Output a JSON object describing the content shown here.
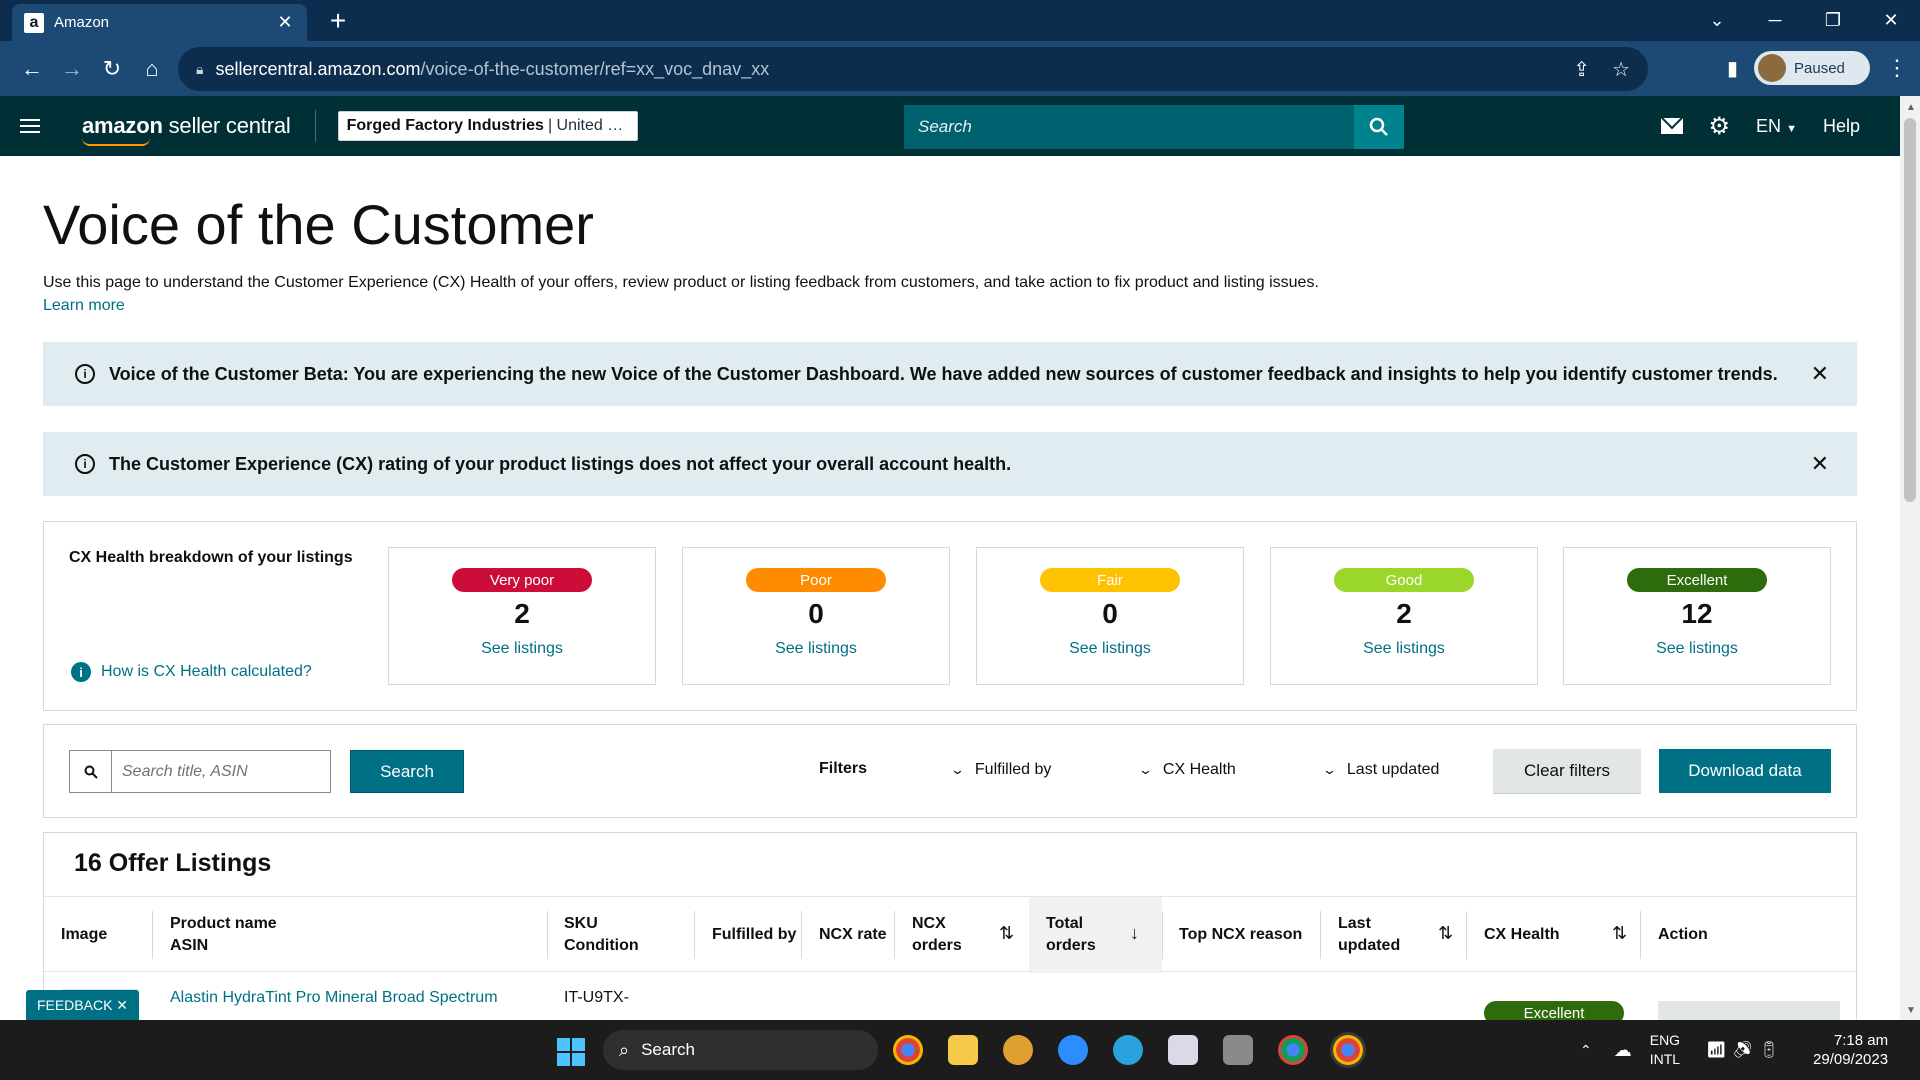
{
  "browser": {
    "tab_title": "Amazon",
    "favicon_letter": "a",
    "url_domain": "sellercentral.amazon.com",
    "url_path": "/voice-of-the-customer/ref=xx_voc_dnav_xx",
    "profile_status": "Paused"
  },
  "header": {
    "logo_bold": "amazon",
    "logo_rest": " seller central",
    "store_name": "Forged Factory Industries",
    "store_market": "| United States",
    "search_placeholder": "Search",
    "language": "EN",
    "help": "Help"
  },
  "page": {
    "title": "Voice of the Customer",
    "description": "Use this page to understand the Customer Experience (CX) Health of your offers, review product or listing feedback from customers, and take action to fix product and listing issues.",
    "learn_more": "Learn more"
  },
  "banners": [
    {
      "text": "Voice of the Customer Beta: You are experiencing the new Voice of the Customer Dashboard. We have added new sources of customer feedback and insights to help you identify customer trends."
    },
    {
      "text": "The Customer Experience (CX) rating of your product listings does not affect your overall account health."
    }
  ],
  "cx_health": {
    "heading": "CX Health breakdown of your listings",
    "how_link": "How is CX Health calculated?",
    "tiles": [
      {
        "label": "Very poor",
        "count": "2",
        "link": "See listings",
        "color": "#cc0c39"
      },
      {
        "label": "Poor",
        "count": "0",
        "link": "See listings",
        "color": "#ff8c00"
      },
      {
        "label": "Fair",
        "count": "0",
        "link": "See listings",
        "color": "#ffc200"
      },
      {
        "label": "Good",
        "count": "2",
        "link": "See listings",
        "color": "#9bd62b"
      },
      {
        "label": "Excellent",
        "count": "12",
        "link": "See listings",
        "color": "#2e6b0c"
      }
    ]
  },
  "filters": {
    "search_placeholder": "Search title, ASIN",
    "search_button": "Search",
    "label": "Filters",
    "fulfilled_by": "Fulfilled by",
    "cx_health": "CX Health",
    "last_updated": "Last updated",
    "clear": "Clear filters",
    "download": "Download data"
  },
  "listings": {
    "title": "16 Offer Listings",
    "columns": {
      "image": "Image",
      "product_name": "Product name",
      "asin": "ASIN",
      "sku": "SKU",
      "condition": "Condition",
      "fulfilled_by": "Fulfilled by",
      "ncx_rate": "NCX rate",
      "ncx": "NCX",
      "orders": "orders",
      "total": "Total",
      "top_ncx_reason": "Top NCX reason",
      "last": "Last",
      "updated": "updated",
      "cx_health": "CX Health",
      "action": "Action"
    },
    "first_row": {
      "product": "Alastin HydraTint Pro Mineral Broad Spectrum",
      "sku": "IT-U9TX-",
      "cx_health": "Excellent"
    }
  },
  "feedback": "FEEDBACK ✕",
  "taskbar": {
    "search": "Search",
    "lang_line1": "ENG",
    "lang_line2": "INTL",
    "time": "7:18 am",
    "date": "29/09/2023"
  }
}
